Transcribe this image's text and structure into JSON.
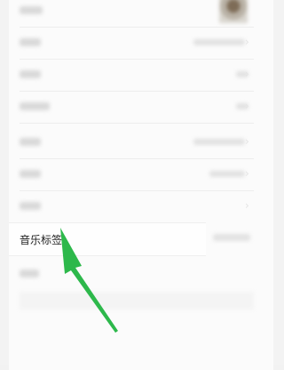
{
  "music_tag": {
    "label": "音乐标签"
  },
  "rows": [
    {
      "name": "row-1"
    },
    {
      "name": "row-2"
    },
    {
      "name": "row-3"
    },
    {
      "name": "row-4"
    },
    {
      "name": "row-5"
    },
    {
      "name": "row-6"
    },
    {
      "name": "row-7"
    }
  ],
  "colors": {
    "arrow": "#2db84b",
    "background": "#f3f3f3",
    "card": "#fbfbfb"
  },
  "icons": {
    "chevron": "chevron-right-icon",
    "arrow": "pointer-arrow-icon"
  }
}
